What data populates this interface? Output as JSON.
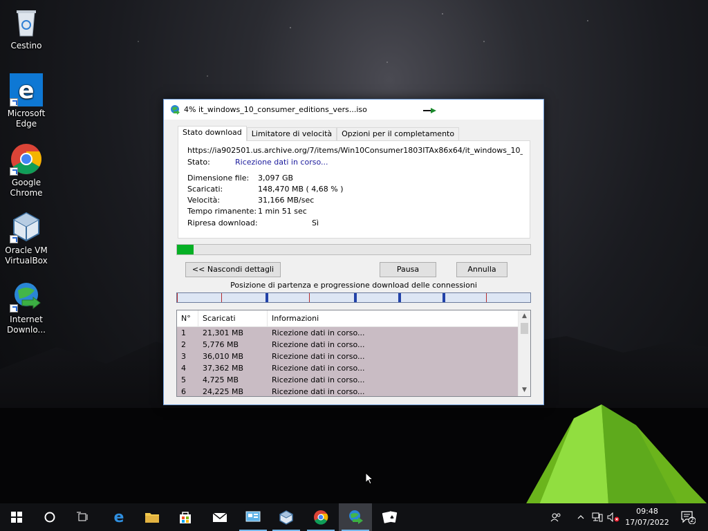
{
  "desktop": {
    "icons": [
      {
        "label": "Cestino"
      },
      {
        "label": "Microsoft Edge"
      },
      {
        "label": "Google Chrome"
      },
      {
        "label": "Oracle VM VirtualBox"
      },
      {
        "label": "Internet Downlo..."
      }
    ]
  },
  "window": {
    "title": "4% it_windows_10_consumer_editions_vers...iso",
    "tabs": [
      "Stato download",
      "Limitatore di velocità",
      "Opzioni per il completamento"
    ],
    "url": "https://ia902501.us.archive.org/7/items/Win10Consumer1803ITAx86x64/it_windows_10_consumer_",
    "status_label": "Stato:",
    "status_value": "Ricezione dati in corso...",
    "details": [
      {
        "label": "Dimensione file:",
        "value": "3,097  GB"
      },
      {
        "label": "Scaricati:",
        "value": "148,470  MB  ( 4,68 % )"
      },
      {
        "label": "Velocità:",
        "value": "31,166  MB/sec"
      },
      {
        "label": "Tempo rimanente:",
        "value": "1 min 51 sec"
      },
      {
        "label": "Ripresa download:",
        "value": "Sì"
      }
    ],
    "progress_fraction": 0.0468,
    "buttons": {
      "hide_details": "<< Nascondi dettagli",
      "pause": "Pausa",
      "cancel": "Annulla"
    },
    "connections_caption": "Posizione di partenza e progressione download delle connessioni",
    "list": {
      "columns": [
        "N°",
        "Scaricati",
        "Informazioni"
      ],
      "rows": [
        [
          "1",
          "21,301  MB",
          "Ricezione dati in corso..."
        ],
        [
          "2",
          "5,776  MB",
          "Ricezione dati in corso..."
        ],
        [
          "3",
          "36,010  MB",
          "Ricezione dati in corso..."
        ],
        [
          "4",
          "37,362  MB",
          "Ricezione dati in corso..."
        ],
        [
          "5",
          "4,725  MB",
          "Ricezione dati in corso..."
        ],
        [
          "6",
          "24,225  MB",
          "Ricezione dati in corso..."
        ]
      ]
    }
  },
  "taskbar": {
    "time": "09:48",
    "date": "17/07/2022",
    "notification_count": "2"
  },
  "colors": {
    "progress": "#06b025",
    "accent": "#76b9ed",
    "status_text": "#1a1a9c"
  }
}
